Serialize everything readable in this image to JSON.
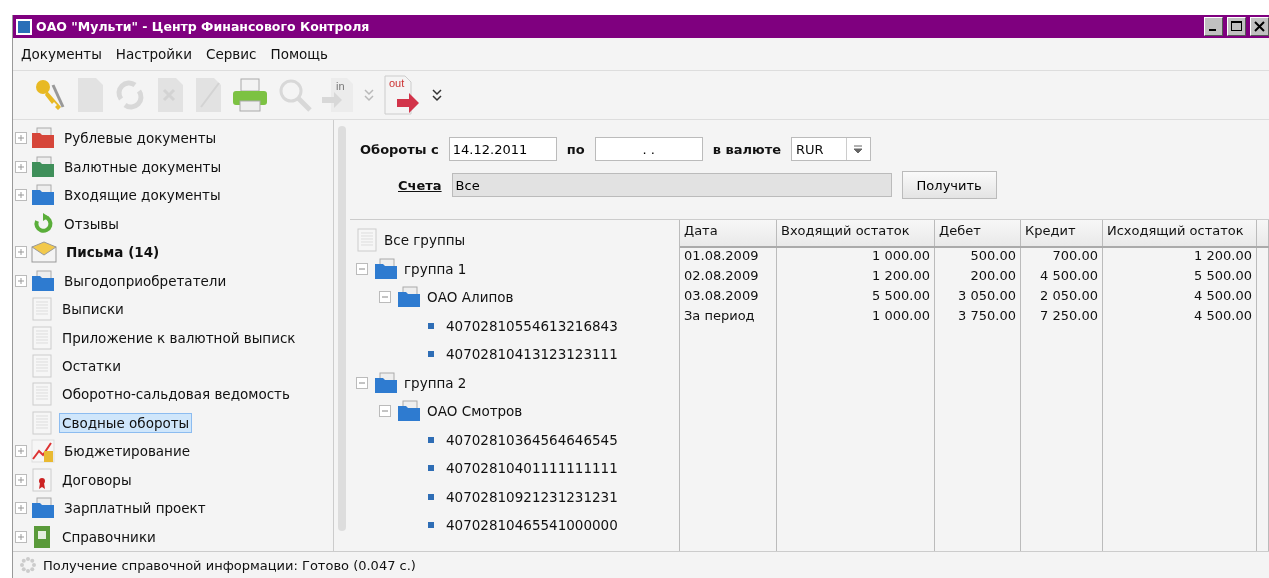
{
  "window": {
    "title": "ОАО \"Мульти\" - Центр Финансового Контроля"
  },
  "menu": [
    "Документы",
    "Настройки",
    "Сервис",
    "Помощь"
  ],
  "toolbar": [
    {
      "kind": "keys",
      "disabled": false
    },
    {
      "kind": "document",
      "disabled": true
    },
    {
      "kind": "refresh",
      "disabled": true
    },
    {
      "kind": "delete",
      "disabled": true
    },
    {
      "kind": "sign",
      "disabled": true
    },
    {
      "kind": "print",
      "disabled": false
    },
    {
      "kind": "search",
      "disabled": true
    },
    {
      "kind": "import",
      "disabled": true,
      "label": "in"
    },
    {
      "kind": "more",
      "disabled": true
    },
    {
      "kind": "export",
      "disabled": false,
      "label": "out"
    },
    {
      "kind": "more",
      "disabled": false
    }
  ],
  "sidebar": {
    "items": [
      {
        "label": "Рублевые документы",
        "kind": "folder-rub",
        "expandable": true,
        "bold": false,
        "selected": false
      },
      {
        "label": "Валютные документы",
        "kind": "folder-usd",
        "expandable": true,
        "bold": false,
        "selected": false
      },
      {
        "label": "Входящие документы",
        "kind": "folder-in",
        "expandable": true,
        "bold": false,
        "selected": false
      },
      {
        "label": "Отзывы",
        "kind": "refresh",
        "expandable": false,
        "bold": false,
        "selected": false
      },
      {
        "label": "Письма (14)",
        "kind": "envelope",
        "expandable": true,
        "bold": true,
        "selected": false
      },
      {
        "label": "Выгодоприобретатели",
        "kind": "folder",
        "expandable": true,
        "bold": false,
        "selected": false
      },
      {
        "label": "Выписки",
        "kind": "doc",
        "expandable": false,
        "bold": false,
        "selected": false
      },
      {
        "label": "Приложение к валютной выписк",
        "kind": "doc",
        "expandable": false,
        "bold": false,
        "selected": false
      },
      {
        "label": "Остатки",
        "kind": "doc",
        "expandable": false,
        "bold": false,
        "selected": false
      },
      {
        "label": "Оборотно-сальдовая ведомость",
        "kind": "doc",
        "expandable": false,
        "bold": false,
        "selected": false
      },
      {
        "label": "Сводные обороты",
        "kind": "doc",
        "expandable": false,
        "bold": false,
        "selected": true
      },
      {
        "label": "Бюджетирование",
        "kind": "chart",
        "expandable": true,
        "bold": false,
        "selected": false
      },
      {
        "label": "Договоры",
        "kind": "contract",
        "expandable": true,
        "bold": false,
        "selected": false
      },
      {
        "label": "Зарплатный проект",
        "kind": "folder",
        "expandable": true,
        "bold": false,
        "selected": false
      },
      {
        "label": "Справочники",
        "kind": "book",
        "expandable": true,
        "bold": false,
        "selected": false
      }
    ]
  },
  "filter": {
    "from_label": "Обороты с",
    "from_value": "14.12.2011",
    "to_label": "по",
    "to_value": ". .",
    "currency_label": "в валюте",
    "currency": "RUR",
    "accounts_label": "Счета",
    "accounts_value": "Все",
    "get_button": "Получить"
  },
  "groups": [
    {
      "label": "Все группы",
      "kind": "all"
    },
    {
      "label": "группа 1",
      "kind": "folder",
      "expanded": true,
      "children": [
        {
          "label": "ОАО Алипов",
          "kind": "folder",
          "expanded": true,
          "children": [
            {
              "label": "40702810554613216843",
              "kind": "account"
            },
            {
              "label": "40702810413123123111",
              "kind": "account"
            }
          ]
        }
      ]
    },
    {
      "label": "группа 2",
      "kind": "folder",
      "expanded": true,
      "children": [
        {
          "label": "ОАО Смотров",
          "kind": "folder",
          "expanded": true,
          "children": [
            {
              "label": "40702810364564646545",
              "kind": "account"
            },
            {
              "label": "40702810401111111111",
              "kind": "account"
            },
            {
              "label": "40702810921231231231",
              "kind": "account"
            },
            {
              "label": "40702810465541000000",
              "kind": "account"
            }
          ]
        }
      ]
    }
  ],
  "table": {
    "columns": [
      "Дата",
      "Входящий остаток",
      "Дебет",
      "Кредит",
      "Исходящий остаток"
    ],
    "rows": [
      [
        "01.08.2009",
        "1 000.00",
        "500.00",
        "700.00",
        "1 200.00"
      ],
      [
        "02.08.2009",
        "1 200.00",
        "200.00",
        "4 500.00",
        "5 500.00"
      ],
      [
        "03.08.2009",
        "5 500.00",
        "3 050.00",
        "2 050.00",
        "4 500.00"
      ],
      [
        "За период",
        "1 000.00",
        "3 750.00",
        "7 250.00",
        "4 500.00"
      ]
    ]
  },
  "status_bar": "Получение справочной информации: Готово (0.047 с.)"
}
